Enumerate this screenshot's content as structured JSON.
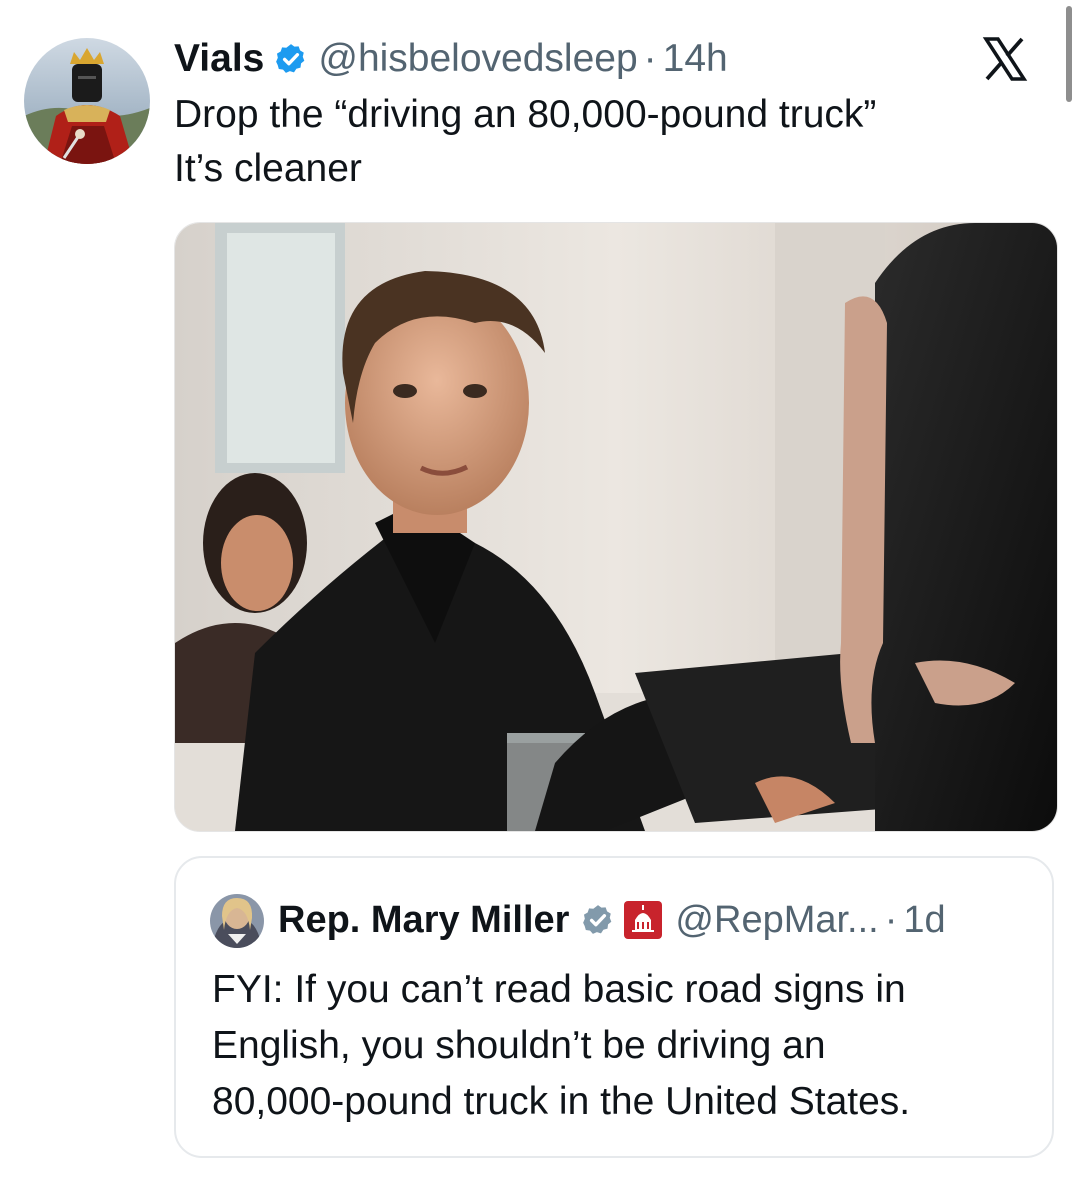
{
  "tweet": {
    "author": {
      "display_name": "Vials",
      "handle": "@hisbelovedsleep",
      "verified": true,
      "avatar_icon": "crowned-knight-avatar"
    },
    "separator": "·",
    "time": "14h",
    "text_lines": [
      "Drop the “driving an 80,000-pound truck”",
      "It’s cleaner"
    ],
    "media": {
      "type": "photo",
      "icon": "movie-still-photo"
    }
  },
  "platform": {
    "logo_icon": "x-logo-icon"
  },
  "quoted_tweet": {
    "author": {
      "display_name": "Rep. Mary Miller",
      "handle": "@RepMar...",
      "verified": true,
      "verified_color": "#829aab",
      "affiliation_icon": "capitol-gop-badge-icon",
      "avatar_icon": "woman-portrait-avatar"
    },
    "separator": "·",
    "time": "1d",
    "text_lines": [
      "FYI: If you can’t read basic road signs in",
      "English, you shouldn’t be driving an",
      "80,000-pound truck in the United States."
    ]
  },
  "colors": {
    "text_primary": "#0f1419",
    "text_secondary": "#536471",
    "verified_blue": "#1d9bf0",
    "border": "#e6e9ec"
  }
}
